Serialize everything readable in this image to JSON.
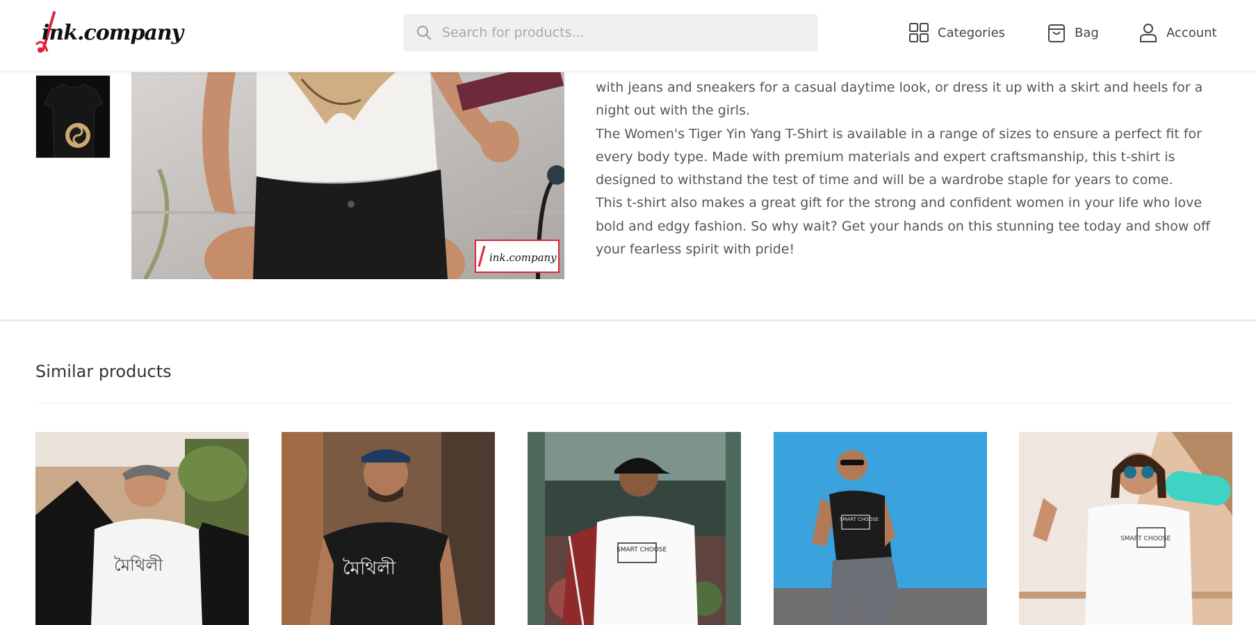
{
  "header": {
    "logo_text": "ink.company",
    "search_placeholder": "Search for products...",
    "nav": {
      "categories": "Categories",
      "bag": "Bag",
      "account": "Account"
    }
  },
  "product": {
    "thumbnail_alt": "Tiger Yin Yang T-Shirt black",
    "main_image_alt": "Women's Tiger Yin Yang T-Shirt",
    "watermark": "ink.company",
    "description": [
      "with jeans and sneakers for a casual daytime look, or dress it up with a skirt and heels for a night out with the girls.",
      "The Women's Tiger Yin Yang T-Shirt is available in a range of sizes to ensure a perfect fit for every body type. Made with premium materials and expert craftsmanship, this t-shirt is designed to withstand the test of time and will be a wardrobe staple for years to come.",
      "This t-shirt also makes a great gift for the strong and confident women in your life who love bold and edgy fashion. So why wait? Get your hands on this stunning tee today and show off your fearless spirit with pride!"
    ]
  },
  "similar": {
    "title": "Similar products",
    "items": [
      {
        "shirt_text": "মৈথিলী",
        "bg": "#c9a98a",
        "shirt": "#f4f4f4"
      },
      {
        "shirt_text": "মৈথিলী",
        "bg": "#7b5a44",
        "shirt": "#1a1a1a"
      },
      {
        "shirt_text": "SMART CHOOSE",
        "bg": "#4d6a5d",
        "shirt": "#fafafa"
      },
      {
        "shirt_text": "SMART CHOOSE",
        "bg": "#3aa2dc",
        "shirt": "#1c1c1c"
      },
      {
        "shirt_text": "SMART CHOOSE",
        "bg": "#efe7df",
        "shirt": "#fafafa"
      }
    ]
  },
  "colors": {
    "accent": "#e0223a",
    "search_bg": "#f0f0f0",
    "text": "#555555"
  }
}
